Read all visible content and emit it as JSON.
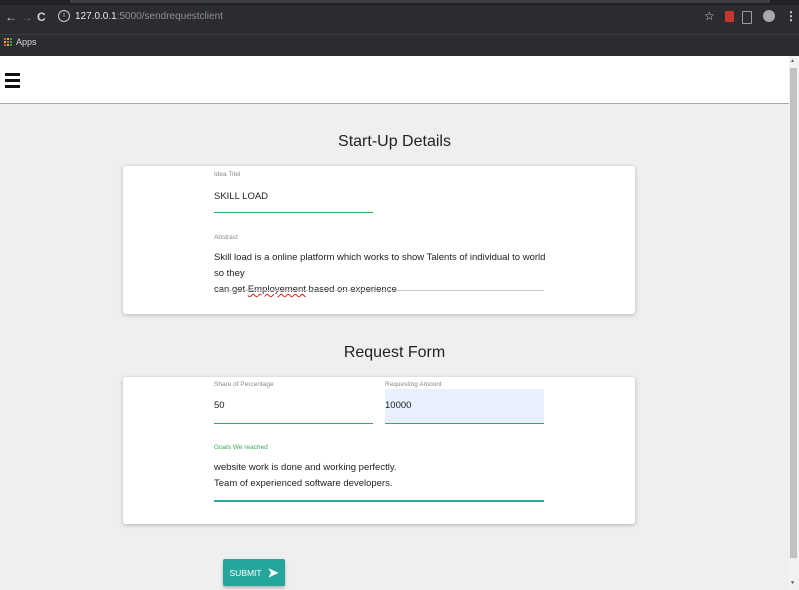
{
  "browser": {
    "back_icon": "arrow-left",
    "forward_icon": "arrow-right",
    "reload_icon": "reload",
    "url_host": "127.0.0.1",
    "url_path": ":5000/sendrequestclient",
    "bookmark_label": "Apps"
  },
  "startup": {
    "title": "Start-Up Details",
    "idea_title_label": "Idea Titel",
    "idea_title_value": "SKILL LOAD",
    "abstract_label": "Abstract",
    "abstract_line1": "Skill load is a online platform which works to show Talents of individual to world so they",
    "abstract_line2_pre": "can get ",
    "abstract_line2_misspelled": "Employement",
    "abstract_line2_post": " based on experience"
  },
  "request": {
    "title": "Request Form",
    "share_label": "Share of Percentage",
    "share_value": "50",
    "amount_label": "Requesting Amount",
    "amount_value": "10000",
    "goals_label": "Goals We reached",
    "goals_line1": "website work is done and working perfectly.",
    "goals_line2": "Team of experienced software developers."
  },
  "submit_label": "SUBMIT",
  "colors": {
    "accent_green": "#3aa856",
    "button_teal": "#26a69a",
    "autofill_bg": "#e8f0fe"
  }
}
